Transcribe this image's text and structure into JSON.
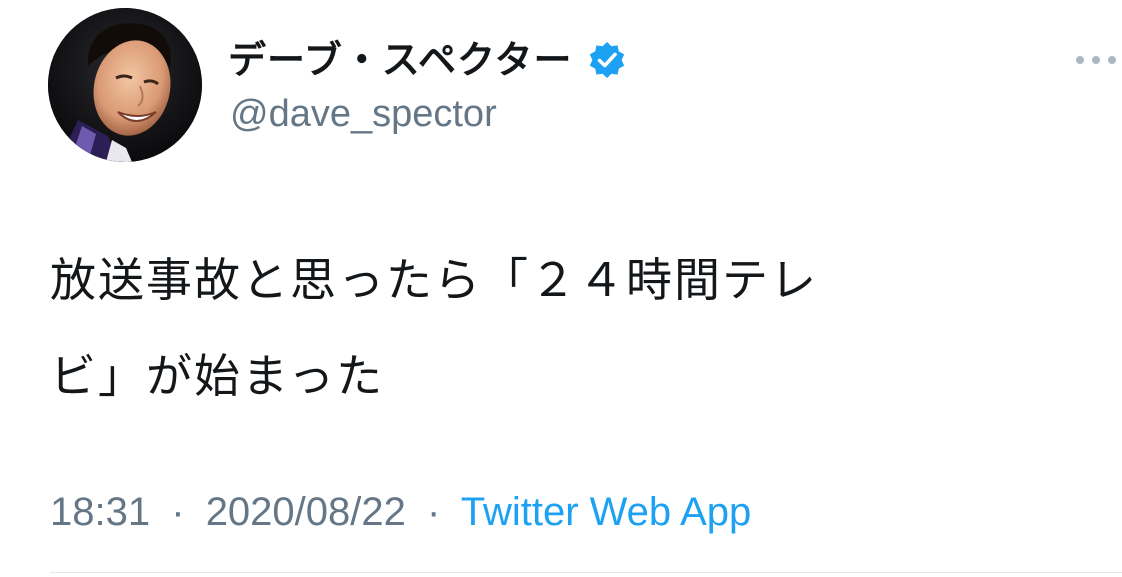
{
  "user": {
    "display_name": "デーブ・スペクター",
    "handle": "@dave_spector",
    "verified_icon": "verified-badge-icon",
    "avatar_icon": "profile-photo"
  },
  "tweet": {
    "text_line1": "放送事故と思ったら「２４時間テレ",
    "text_line2": "ビ」が始まった"
  },
  "meta": {
    "time": "18:31",
    "separator": "·",
    "date": "2020/08/22",
    "source": "Twitter Web App"
  },
  "actions": {
    "more_icon": "more-options-icon"
  },
  "colors": {
    "text": "#14171a",
    "secondary": "#657786",
    "accent": "#1da1f2",
    "divider": "#e1e8ed"
  }
}
